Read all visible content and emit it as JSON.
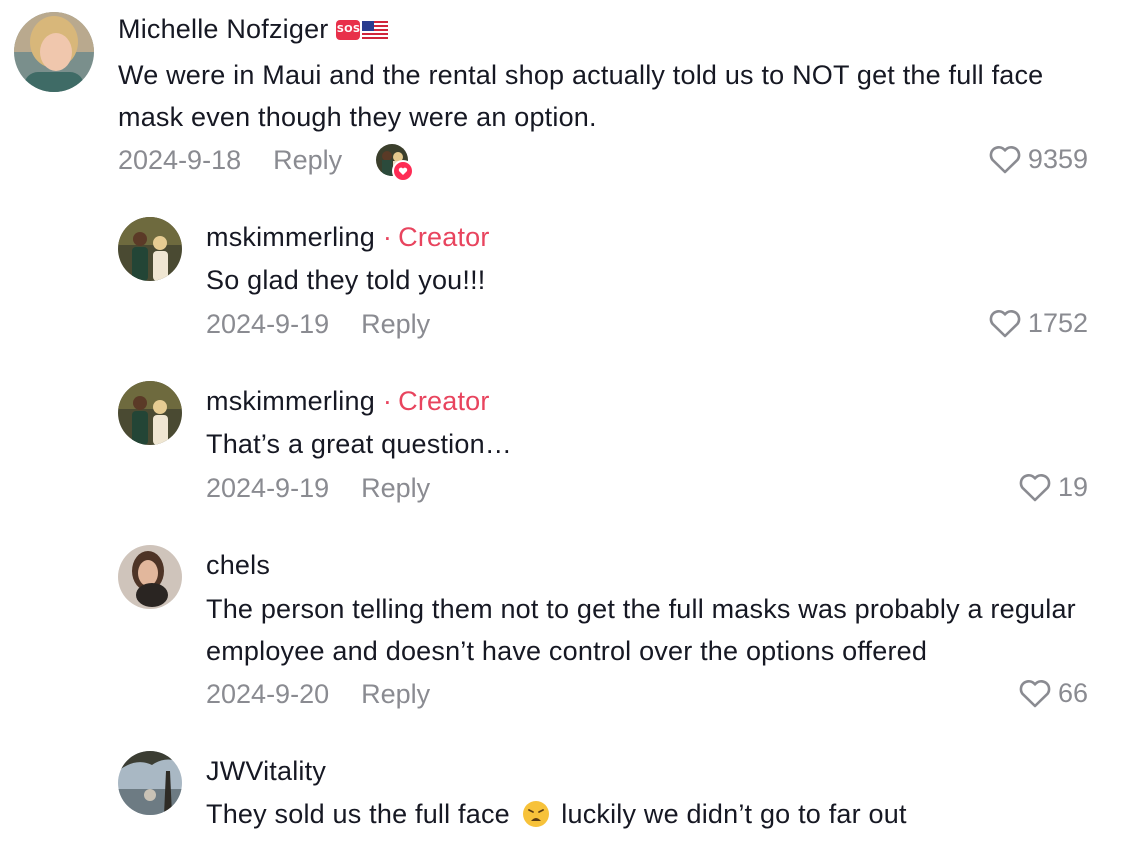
{
  "comments": [
    {
      "username": "Michelle Nofziger",
      "badges": [
        "sos-icon",
        "us-flag-icon"
      ],
      "text": "We were in Maui and the rental shop actually told us to NOT get the full face mask even though they were an option.",
      "date": "2024-9-18",
      "reply_label": "Reply",
      "likes": "9359",
      "creator_liked": true
    },
    {
      "username": "mskimmerling",
      "creator_dot": "·",
      "creator_label": "Creator",
      "text": "So glad they told you!!!",
      "date": "2024-9-19",
      "reply_label": "Reply",
      "likes": "1752"
    },
    {
      "username": "mskimmerling",
      "creator_dot": "·",
      "creator_label": "Creator",
      "text": "That’s a great question…",
      "date": "2024-9-19",
      "reply_label": "Reply",
      "likes": "19"
    },
    {
      "username": "chels",
      "text": "The person telling them not to get the full masks was probably a regular employee and doesn’t have control over the options offered",
      "date": "2024-9-20",
      "reply_label": "Reply",
      "likes": "66"
    },
    {
      "username": "JWVitality",
      "text_before": "They sold us the full face",
      "text_emoji": "weary-face-emoji",
      "text_after": "luckily we didn’t go to far out"
    }
  ],
  "colors": {
    "creator": "#e8445e",
    "meta": "#8a8b91",
    "text": "#161823",
    "heart_badge": "#fe2c55"
  }
}
